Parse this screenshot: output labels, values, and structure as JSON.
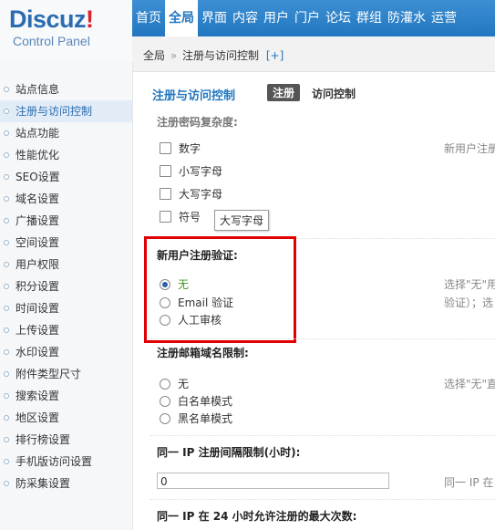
{
  "logo": {
    "brand": "Discuz",
    "bang": "!",
    "sub": "Control Panel"
  },
  "nav": [
    "首页",
    "全局",
    "界面",
    "内容",
    "用户",
    "门户",
    "论坛",
    "群组",
    "防灌水",
    "运营"
  ],
  "breadcrumb": {
    "root": "全局",
    "sep": "»",
    "page": "注册与访问控制",
    "plus": "[+]"
  },
  "sidebar": [
    "站点信息",
    "注册与访问控制",
    "站点功能",
    "性能优化",
    "SEO设置",
    "域名设置",
    "广播设置",
    "空间设置",
    "用户权限",
    "积分设置",
    "时间设置",
    "上传设置",
    "水印设置",
    "附件类型尺寸",
    "搜索设置",
    "地区设置",
    "排行榜设置",
    "手机版访问设置",
    "防采集设置"
  ],
  "main": {
    "title": "注册与访问控制",
    "tab_active": "注册",
    "tab": "访问控制",
    "cut_title": "注册密码复杂度:",
    "complexity": {
      "options": [
        "数字",
        "小写字母",
        "大写字母",
        "符号"
      ],
      "hint": "新用户注册",
      "tooltip": "大写字母"
    },
    "verify": {
      "title": "新用户注册验证:",
      "options": [
        "无",
        "Email 验证",
        "人工审核"
      ],
      "hint1": "选择\"无\"用",
      "hint2": "验证）；选"
    },
    "email": {
      "title": "注册邮箱域名限制:",
      "options": [
        "无",
        "白名单模式",
        "黑名单模式"
      ],
      "hint": "选择\"无\"直"
    },
    "ip": {
      "title": "同一 IP 注册间隔限制(小时):",
      "value": "0",
      "hint": "同一 IP 在"
    },
    "ip24": {
      "title": "同一 IP 在 24 小时允许注册的最大次数:"
    }
  }
}
